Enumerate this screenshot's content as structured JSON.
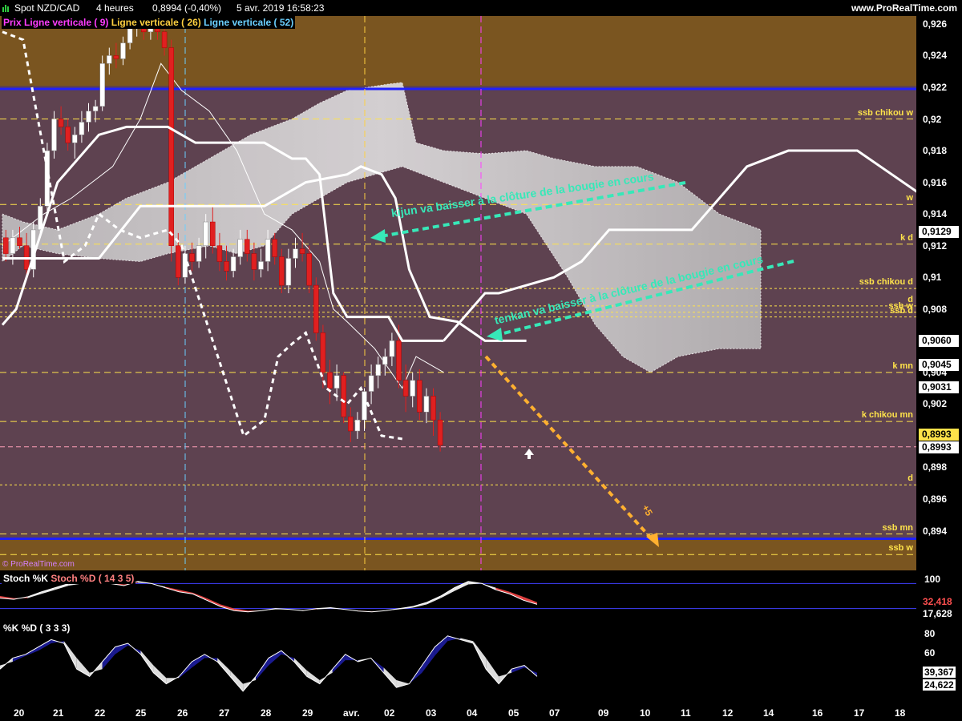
{
  "header": {
    "instrument": "Spot NZD/CAD",
    "timeframe": "4 heures",
    "last": "0,8994 (-0,40%)",
    "datetime": "5 avr. 2019 16:58:23",
    "site": "www.ProRealTime.com"
  },
  "legend": {
    "price": "Prix",
    "vl9": "Ligne verticale ( 9)",
    "vl26": "Ligne verticale ( 26)",
    "vl52": "Ligne verticale ( 52)"
  },
  "watermark": "© ProRealTime.com",
  "colors": {
    "background": "#5e4250",
    "band": "#7a5520",
    "bull": "#ffffff",
    "bear": "#e02020",
    "level": "#ffe34a",
    "annotation": "#37e8b8",
    "arrow": "#ffb030",
    "blue_line": "#2020ff"
  },
  "chart_data": {
    "type": "candlestick",
    "ylim": [
      0.8915,
      0.9265
    ],
    "y_ticks": [
      "0,926",
      "0,924",
      "0,922",
      "0,92",
      "0,918",
      "0,916",
      "0,914",
      "0,912",
      "0,91",
      "0,908",
      "0,904",
      "0,902",
      "0,898",
      "0,896",
      "0,894"
    ],
    "y_tick_values": [
      0.926,
      0.924,
      0.922,
      0.92,
      0.918,
      0.916,
      0.914,
      0.912,
      0.91,
      0.908,
      0.904,
      0.902,
      0.898,
      0.896,
      0.894
    ],
    "x_ticks": [
      "20",
      "21",
      "22",
      "25",
      "26",
      "27",
      "28",
      "29",
      "avr.",
      "02",
      "03",
      "04",
      "05",
      "07",
      "09",
      "10",
      "11",
      "12",
      "14",
      "16",
      "17",
      "18"
    ],
    "price_boxes": [
      {
        "label": "0,9129",
        "value": 0.9129,
        "style": "white"
      },
      {
        "label": "0,9060",
        "value": 0.906,
        "style": "white"
      },
      {
        "label": "0,9045",
        "value": 0.9045,
        "style": "white"
      },
      {
        "label": "0,9031",
        "value": 0.9031,
        "style": "white"
      },
      {
        "label": "0,8993",
        "value": 0.8993,
        "style": "yellow"
      },
      {
        "label": "0,8993",
        "value": 0.8993,
        "style": "white"
      }
    ],
    "blue_lines": [
      0.9219,
      0.8935
    ],
    "levels": [
      {
        "label": "ssb chikou w",
        "value": 0.92,
        "dash": "long"
      },
      {
        "label": "w",
        "value": 0.9146,
        "dash": "long"
      },
      {
        "label": "k d",
        "value": 0.9121,
        "dash": "long"
      },
      {
        "label": "ssb chikou d",
        "value": 0.9093,
        "dash": "short"
      },
      {
        "label": "d",
        "value": 0.9082,
        "dash": "short"
      },
      {
        "label": "ssb w",
        "value": 0.9078,
        "dash": "short"
      },
      {
        "label": "ssb d",
        "value": 0.9075,
        "dash": "short"
      },
      {
        "label": "k mn",
        "value": 0.904,
        "dash": "long"
      },
      {
        "label": "k chikou mn",
        "value": 0.9009,
        "dash": "long"
      },
      {
        "label": "d",
        "value": 0.8969,
        "dash": "short"
      },
      {
        "label": "ssb mn",
        "value": 0.8938,
        "dash": "long"
      },
      {
        "label": "ssb w",
        "value": 0.8925,
        "dash": "long"
      }
    ],
    "candles": [
      [
        0.9125,
        0.913,
        0.911,
        0.9115
      ],
      [
        0.9115,
        0.913,
        0.9108,
        0.9125
      ],
      [
        0.9125,
        0.9132,
        0.9118,
        0.912
      ],
      [
        0.912,
        0.9128,
        0.91,
        0.9105
      ],
      [
        0.9105,
        0.9135,
        0.91,
        0.913
      ],
      [
        0.913,
        0.915,
        0.9125,
        0.9145
      ],
      [
        0.9145,
        0.9185,
        0.914,
        0.918
      ],
      [
        0.918,
        0.9205,
        0.9175,
        0.92
      ],
      [
        0.92,
        0.9208,
        0.919,
        0.9195
      ],
      [
        0.9195,
        0.92,
        0.918,
        0.9185
      ],
      [
        0.9185,
        0.9195,
        0.9175,
        0.919
      ],
      [
        0.919,
        0.9205,
        0.9185,
        0.9198
      ],
      [
        0.9198,
        0.921,
        0.9192,
        0.9205
      ],
      [
        0.9205,
        0.9212,
        0.9198,
        0.9208
      ],
      [
        0.9208,
        0.924,
        0.9205,
        0.9235
      ],
      [
        0.9235,
        0.9245,
        0.9228,
        0.924
      ],
      [
        0.924,
        0.9248,
        0.9232,
        0.9238
      ],
      [
        0.9238,
        0.9252,
        0.9234,
        0.9248
      ],
      [
        0.9248,
        0.9262,
        0.9244,
        0.9258
      ],
      [
        0.9258,
        0.9268,
        0.9252,
        0.9262
      ],
      [
        0.9262,
        0.9268,
        0.925,
        0.9255
      ],
      [
        0.9255,
        0.9264,
        0.925,
        0.926
      ],
      [
        0.926,
        0.9265,
        0.925,
        0.9255
      ],
      [
        0.9255,
        0.9262,
        0.924,
        0.9245
      ],
      [
        0.9245,
        0.925,
        0.911,
        0.912
      ],
      [
        0.912,
        0.9128,
        0.9095,
        0.91
      ],
      [
        0.91,
        0.912,
        0.9096,
        0.9115
      ],
      [
        0.9115,
        0.9122,
        0.9104,
        0.911
      ],
      [
        0.911,
        0.9125,
        0.9106,
        0.912
      ],
      [
        0.912,
        0.914,
        0.9112,
        0.9135
      ],
      [
        0.9135,
        0.9145,
        0.9115,
        0.912
      ],
      [
        0.912,
        0.9128,
        0.9104,
        0.911
      ],
      [
        0.911,
        0.912,
        0.9098,
        0.9104
      ],
      [
        0.9104,
        0.9118,
        0.91,
        0.9113
      ],
      [
        0.9113,
        0.913,
        0.9108,
        0.9124
      ],
      [
        0.9124,
        0.913,
        0.911,
        0.9115
      ],
      [
        0.9115,
        0.9122,
        0.9098,
        0.9105
      ],
      [
        0.9105,
        0.9118,
        0.91,
        0.911
      ],
      [
        0.911,
        0.913,
        0.9104,
        0.9124
      ],
      [
        0.9124,
        0.9128,
        0.9108,
        0.9113
      ],
      [
        0.9113,
        0.9118,
        0.909,
        0.9095
      ],
      [
        0.9095,
        0.9118,
        0.909,
        0.9112
      ],
      [
        0.9112,
        0.9125,
        0.9106,
        0.9118
      ],
      [
        0.9118,
        0.9128,
        0.911,
        0.9115
      ],
      [
        0.9115,
        0.912,
        0.909,
        0.9095
      ],
      [
        0.9095,
        0.91,
        0.906,
        0.9065
      ],
      [
        0.9065,
        0.907,
        0.903,
        0.904
      ],
      [
        0.904,
        0.9048,
        0.902,
        0.903
      ],
      [
        0.903,
        0.9045,
        0.9022,
        0.9038
      ],
      [
        0.9038,
        0.904,
        0.9008,
        0.9012
      ],
      [
        0.9012,
        0.9018,
        0.8996,
        0.9003
      ],
      [
        0.9003,
        0.9015,
        0.8998,
        0.901
      ],
      [
        0.901,
        0.903,
        0.9003,
        0.9028
      ],
      [
        0.9028,
        0.9045,
        0.902,
        0.9038
      ],
      [
        0.9038,
        0.905,
        0.903,
        0.9045
      ],
      [
        0.9045,
        0.9055,
        0.9038,
        0.905
      ],
      [
        0.905,
        0.9065,
        0.9044,
        0.906
      ],
      [
        0.906,
        0.907,
        0.903,
        0.9035
      ],
      [
        0.9035,
        0.9045,
        0.9015,
        0.9025
      ],
      [
        0.9025,
        0.904,
        0.9018,
        0.9035
      ],
      [
        0.9035,
        0.9042,
        0.901,
        0.9015
      ],
      [
        0.9015,
        0.903,
        0.9008,
        0.9025
      ],
      [
        0.9025,
        0.903,
        0.9,
        0.901
      ],
      [
        0.901,
        0.9015,
        0.899,
        0.8994
      ]
    ],
    "kijun_bold": [
      [
        0,
        0.907
      ],
      [
        2,
        0.908
      ],
      [
        5,
        0.912
      ],
      [
        8,
        0.916
      ],
      [
        10,
        0.917
      ],
      [
        14,
        0.919
      ],
      [
        18,
        0.9195
      ],
      [
        24,
        0.9195
      ],
      [
        28,
        0.9185
      ],
      [
        30,
        0.9185
      ],
      [
        38,
        0.9185
      ],
      [
        42,
        0.9175
      ],
      [
        44,
        0.9175
      ],
      [
        46,
        0.9165
      ],
      [
        48,
        0.909
      ],
      [
        50,
        0.9075
      ],
      [
        56,
        0.9075
      ],
      [
        58,
        0.906
      ],
      [
        64,
        0.906
      ]
    ],
    "kijun_cont": [
      [
        64,
        0.906
      ],
      [
        66,
        0.907
      ],
      [
        70,
        0.909
      ],
      [
        72,
        0.909
      ],
      [
        80,
        0.91
      ],
      [
        84,
        0.911
      ],
      [
        86,
        0.912
      ],
      [
        88,
        0.913
      ],
      [
        92,
        0.913
      ],
      [
        95,
        0.913
      ],
      [
        100,
        0.913
      ],
      [
        108,
        0.917
      ],
      [
        114,
        0.918
      ],
      [
        124,
        0.918
      ],
      [
        134,
        0.915
      ],
      [
        144,
        0.913
      ],
      [
        150,
        0.913
      ],
      [
        168,
        0.9125
      ]
    ],
    "tenkan": [
      [
        0,
        0.911
      ],
      [
        3,
        0.9112
      ],
      [
        6,
        0.9135
      ],
      [
        10,
        0.916
      ],
      [
        14,
        0.9175
      ],
      [
        18,
        0.92
      ],
      [
        22,
        0.924
      ],
      [
        25,
        0.9245
      ],
      [
        27,
        0.92
      ],
      [
        32,
        0.9175
      ],
      [
        38,
        0.912
      ],
      [
        44,
        0.9113
      ],
      [
        47,
        0.908
      ],
      [
        50,
        0.906
      ],
      [
        53,
        0.904
      ],
      [
        56,
        0.902
      ],
      [
        59,
        0.904
      ],
      [
        62,
        0.904
      ],
      [
        64,
        0.902
      ]
    ],
    "chikou": [
      [
        0,
        0.9255
      ],
      [
        3,
        0.925
      ],
      [
        6,
        0.918
      ],
      [
        9,
        0.911
      ],
      [
        12,
        0.912
      ],
      [
        14,
        0.914
      ],
      [
        17,
        0.913
      ],
      [
        20,
        0.9125
      ],
      [
        24,
        0.913
      ],
      [
        26,
        0.912
      ],
      [
        29,
        0.908
      ],
      [
        32,
        0.904
      ],
      [
        35,
        0.9
      ],
      [
        38,
        0.901
      ],
      [
        40,
        0.905
      ],
      [
        42,
        0.9058
      ],
      [
        44,
        0.9065
      ],
      [
        47,
        0.903
      ],
      [
        50,
        0.902
      ],
      [
        52,
        0.903
      ],
      [
        55,
        0.9
      ],
      [
        58,
        0.8998
      ]
    ],
    "annotations": [
      {
        "text": "kijun va baisser à la clôture de la bougie en cours"
      },
      {
        "text": "tenkan va baisser à la clôture de la bougie en cours"
      },
      {
        "text": "+5"
      }
    ],
    "stoch_fast": {
      "title": "Stoch %K",
      "params": "Stoch %D ( 14 3 5)",
      "ticks": [
        "100",
        "32,418",
        "17,628"
      ],
      "k": [
        45,
        42,
        48,
        60,
        70,
        80,
        85,
        88,
        80,
        75,
        85,
        80,
        70,
        60,
        55,
        40,
        25,
        15,
        12,
        15,
        20,
        18,
        15,
        20,
        22,
        18,
        14,
        12,
        15,
        20,
        25,
        35,
        50,
        70,
        85,
        80,
        65,
        55,
        40,
        30
      ],
      "d": [
        50,
        45,
        45,
        55,
        65,
        75,
        80,
        85,
        82,
        78,
        82,
        80,
        72,
        65,
        58,
        45,
        30,
        20,
        15,
        15,
        18,
        18,
        16,
        18,
        20,
        18,
        15,
        13,
        15,
        18,
        22,
        30,
        45,
        62,
        78,
        80,
        70,
        60,
        48,
        35
      ]
    },
    "stoch_slow": {
      "title": "%K",
      "params": "%D ( 3 3 3)",
      "ticks": [
        "80",
        "60",
        "39,367",
        "24,622"
      ],
      "k": [
        40,
        55,
        60,
        70,
        80,
        75,
        40,
        30,
        50,
        70,
        75,
        60,
        35,
        20,
        30,
        50,
        60,
        50,
        30,
        10,
        30,
        55,
        65,
        50,
        30,
        20,
        40,
        60,
        50,
        55,
        35,
        15,
        20,
        45,
        70,
        85,
        80,
        75,
        40,
        20,
        40,
        45,
        30
      ],
      "d": [
        45,
        50,
        58,
        65,
        75,
        78,
        55,
        35,
        40,
        60,
        72,
        65,
        45,
        28,
        28,
        42,
        55,
        55,
        38,
        20,
        25,
        45,
        60,
        55,
        38,
        25,
        35,
        52,
        52,
        55,
        42,
        25,
        20,
        35,
        58,
        78,
        82,
        78,
        55,
        30,
        35,
        42,
        35
      ]
    }
  }
}
